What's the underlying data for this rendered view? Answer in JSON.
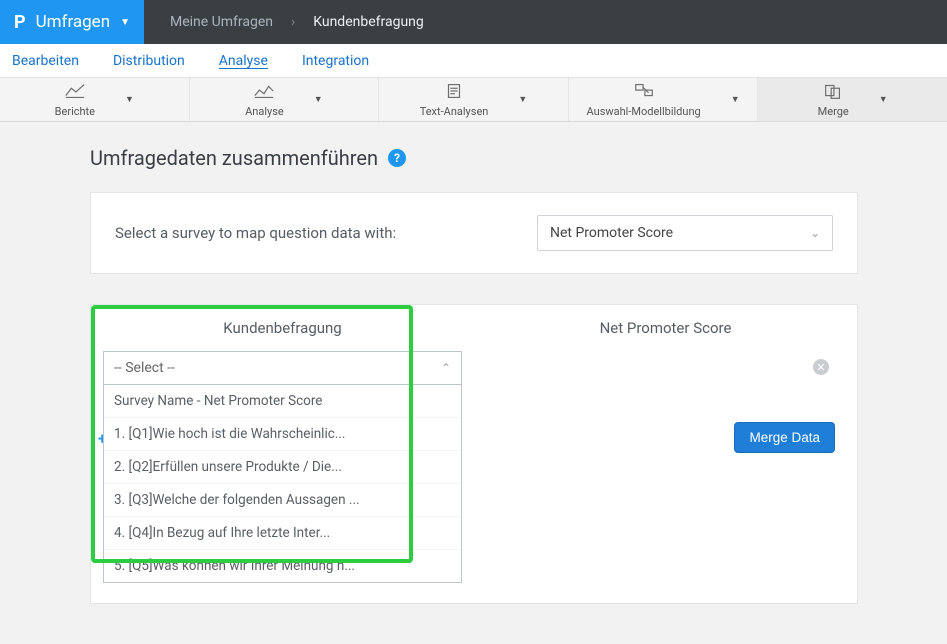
{
  "header": {
    "brand": "Umfragen",
    "breadcrumb_root": "Meine Umfragen",
    "breadcrumb_current": "Kundenbefragung"
  },
  "tabs": {
    "edit": "Bearbeiten",
    "distribution": "Distribution",
    "analysis": "Analyse",
    "integration": "Integration"
  },
  "toolbar": {
    "reports": "Berichte",
    "analysis": "Analyse",
    "text_analysis": "Text-Analysen",
    "choice_modeling": "Auswahl-Modellbildung",
    "merge": "Merge"
  },
  "page": {
    "title": "Umfragedaten zusammenführen",
    "select_label": "Select a survey to map question data with:",
    "selected_survey": "Net Promoter Score"
  },
  "mapping": {
    "source_header": "Kundenbefragung",
    "target_header": "Net Promoter Score",
    "dropdown_placeholder": "-- Select --",
    "options": [
      "Survey Name - Net Promoter Score",
      "1. [Q1]Wie hoch ist die Wahrscheinlic...",
      "2. [Q2]Erfüllen unsere Produkte / Die...",
      "3. [Q3]Welche der folgenden Aussagen ...",
      "4. [Q4]In Bezug auf Ihre letzte Inter...",
      "5. [Q5]Was können wir Ihrer Meinung n..."
    ],
    "merge_button": "Merge Data"
  }
}
